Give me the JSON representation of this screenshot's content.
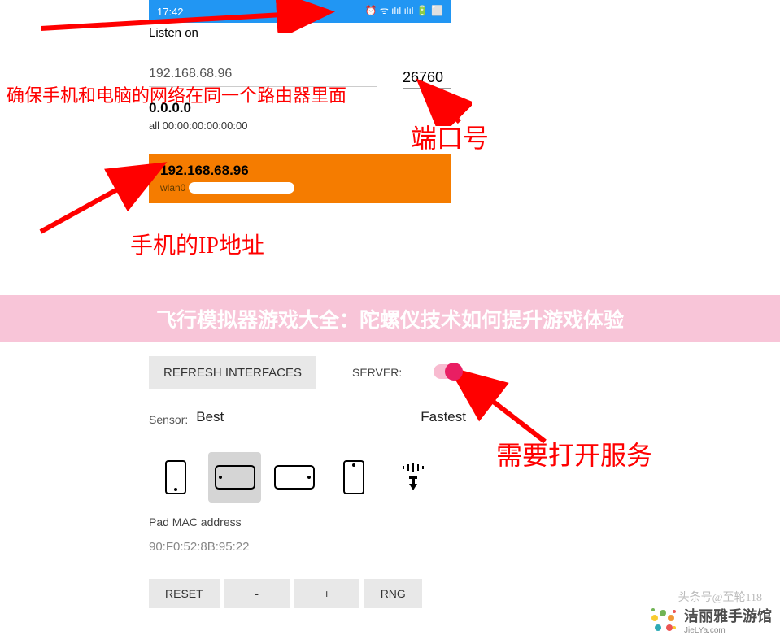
{
  "status": {
    "time": "17:42",
    "icons": "⏰ ᯤ ılıl ılıl 🔋 ⬜"
  },
  "top": {
    "listen": "Listen on",
    "port": "26760",
    "ip1": "192.168.68.96",
    "ip_zero": "0.0.0.0",
    "mac_all": "all 00:00:00:00:00:00",
    "sel_ip": "192.168.68.96",
    "sel_if": "wlan0"
  },
  "annotations": {
    "a1": "确保手机和电脑的网络在同一个路由器里面",
    "a2": "端口号",
    "a3": "手机的IP地址",
    "a4": "需要打开服务"
  },
  "banner": "飞行模拟器游戏大全：陀螺仪技术如何提升游戏体验",
  "bottom": {
    "refresh": "REFRESH INTERFACES",
    "server": "SERVER:",
    "sensor_label": "Sensor:",
    "sensor_best": "Best",
    "sensor_fast": "Fastest",
    "pad_mac": "Pad MAC address",
    "pad_mac_val": "90:F0:52:8B:95:22",
    "reset": "RESET",
    "minus": "-",
    "plus": "+",
    "rng": "RNG"
  },
  "watermark": {
    "name": "洁丽雅手游馆",
    "url": "JieLYa.com",
    "author": "头条号@至轮118"
  }
}
